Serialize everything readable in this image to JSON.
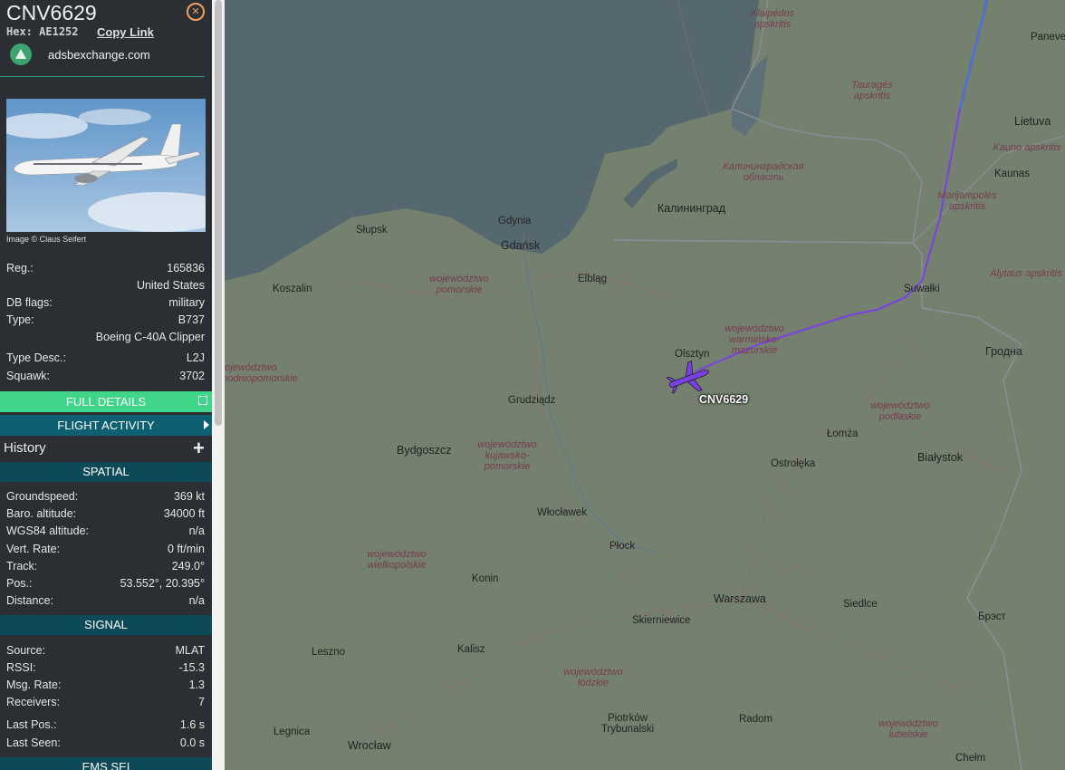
{
  "aircraft": {
    "callsign": "CNV6629",
    "hex_label": "Hex:",
    "hex": "AE1252",
    "copy_link": "Copy Link",
    "source_site": "adsbexchange.com",
    "image_credit": "Image © Claus Seifert"
  },
  "details": [
    {
      "key": "Reg.:",
      "value": "165836"
    },
    {
      "key": "",
      "value": "United States"
    },
    {
      "key": "DB flags:",
      "value": "military"
    },
    {
      "key": "Type:",
      "value": "B737"
    },
    {
      "key": "",
      "value": "Boeing C-40A Clipper"
    },
    {
      "key": "Type Desc.:",
      "value": "L2J"
    },
    {
      "key": "Squawk:",
      "value": "3702"
    }
  ],
  "buttons": {
    "full_details": "FULL DETAILS",
    "flight_activity": "FLIGHT ACTIVITY",
    "history": "History",
    "add": "+"
  },
  "sections": {
    "spatial": "SPATIAL",
    "signal": "SIGNAL",
    "ems": "EMS SEI"
  },
  "spatial": [
    {
      "key": "Groundspeed:",
      "value": "369 kt"
    },
    {
      "key": "Baro. altitude:",
      "value": "34000 ft"
    },
    {
      "key": "WGS84 altitude:",
      "value": "n/a"
    },
    {
      "key": "Vert. Rate:",
      "value": "0 ft/min"
    },
    {
      "key": "Track:",
      "value": "249.0°"
    },
    {
      "key": "Pos.:",
      "value": "53.552°, 20.395°"
    },
    {
      "key": "Distance:",
      "value": "n/a"
    }
  ],
  "signal": [
    {
      "key": "Source:",
      "value": "MLAT"
    },
    {
      "key": "RSSI:",
      "value": "-15.3"
    },
    {
      "key": "Msg. Rate:",
      "value": "1.3"
    },
    {
      "key": "Receivers:",
      "value": "7"
    },
    {
      "key": "Last Pos.:",
      "value": "1.6 s"
    },
    {
      "key": "Last Seen:",
      "value": "0.0 s"
    }
  ],
  "map": {
    "aircraft_label": "CNV6629",
    "track_color": "#7b3fe6",
    "cities": {
      "gdansk": "Gdańsk",
      "gdynia": "Gdynia",
      "slupsk": "Słupsk",
      "koszalin": "Koszalin",
      "elblag": "Elbląg",
      "kaliningrad": "Калининград",
      "olsztyn": "Olsztyn",
      "grudziadz": "Grudziądz",
      "bydgoszcz": "Bydgoszcz",
      "wloclawek": "Włocławek",
      "plock": "Płock",
      "konin": "Konin",
      "warszawa": "Warszawa",
      "lomza": "Łomża",
      "ostroleka": "Ostrołęka",
      "bialystok": "Białystok",
      "suwalki": "Suwałki",
      "siedlce": "Siedlce",
      "skierniewice": "Skierniewice",
      "kalisz": "Kalisz",
      "leszno": "Leszno",
      "wroclaw": "Wrocław",
      "legnica": "Legnica",
      "radom": "Radom",
      "piotrkow": "Piotrków Trybunalski",
      "chelm": "Chełm",
      "kaunas": "Kaunas",
      "grodno": "Гродна",
      "brest": "Брэст",
      "lietuva": "Lietuva",
      "panev": "Paneve"
    },
    "regions": {
      "pomorskie": "województwo pomorskie",
      "warminsko": "województwo warmińsko-mazurskie",
      "podlaskie": "województwo podlaskie",
      "kujawsko": "województwo kujawsko-pomorskie",
      "wielkopolskie": "województwo wielkopolskie",
      "lodzkie": "województwo łódzkie",
      "lubelskie": "województwo lubelskie",
      "zachodnio": "województwo zachodniopomorskie",
      "kaliningrad_obl": "Калининградская область",
      "klaipeda": "Klaipėdos apskritis",
      "taurage": "Tauragės apskritis",
      "kauno": "Kauno apskritis",
      "marijampole": "Marijampolės apskritis",
      "alytus": "Alytaus apskritis"
    }
  }
}
